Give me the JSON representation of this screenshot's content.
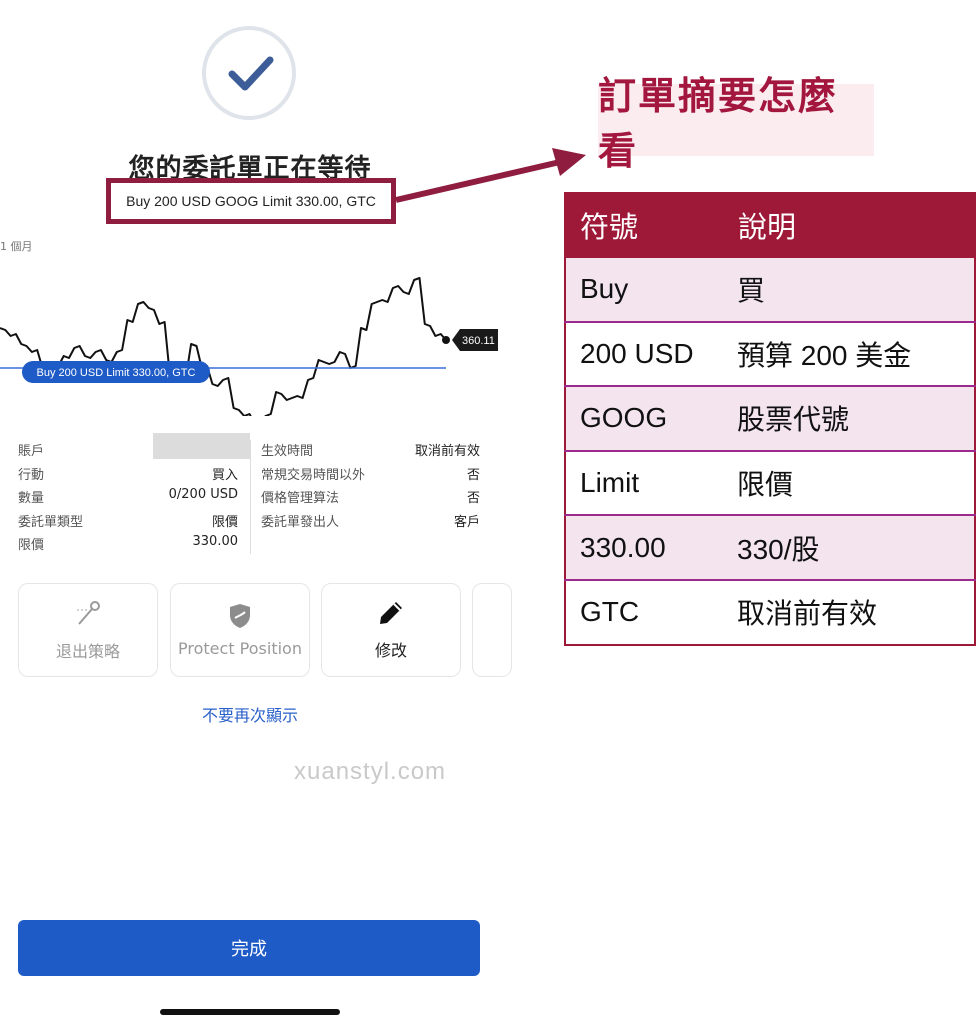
{
  "status": {
    "title": "您的委託單正在等待"
  },
  "order": {
    "summary": "Buy 200 USD GOOG Limit 330.00, GTC"
  },
  "chart": {
    "range_label": "1 個月",
    "last_price_label": "360.11",
    "limit_line_label": "Buy 200 USD Limit 330.00, GTC",
    "colors": {
      "line": "#111111",
      "limit": "#3a6fd8",
      "badge": "#1a1a1a"
    }
  },
  "chart_data": {
    "type": "line",
    "series": [
      {
        "values": [
          340,
          338,
          336,
          334,
          330,
          330,
          333,
          335,
          333,
          334,
          332,
          334,
          342,
          346,
          345,
          341,
          328,
          327,
          336,
          330,
          326,
          327,
          320,
          318,
          316,
          318,
          324,
          322,
          323,
          327,
          332,
          331,
          334,
          330,
          340,
          346,
          347,
          350,
          349,
          352,
          341,
          338,
          337
        ]
      }
    ],
    "reference_lines": [
      {
        "label": "Buy 200 USD Limit 330.00, GTC",
        "value": 330.0
      }
    ],
    "last_value": 360.11,
    "ylim": [
      320,
      362
    ]
  },
  "details": {
    "left": [
      {
        "label": "賬戶",
        "value": ""
      },
      {
        "label": "行動",
        "value": "買入"
      },
      {
        "label": "數量",
        "value": "0/200 USD"
      },
      {
        "label": "委託單類型",
        "value": "限價"
      },
      {
        "label": "限價",
        "value": "330.00"
      }
    ],
    "right": [
      {
        "label": "生效時間",
        "value": "取消前有效"
      },
      {
        "label": "常規交易時間以外",
        "value": "否"
      },
      {
        "label": "價格管理算法",
        "value": "否"
      },
      {
        "label": "委託單發出人",
        "value": "客戶"
      }
    ]
  },
  "actions": [
    {
      "label": "退出策略",
      "icon": "exit-strategy-icon"
    },
    {
      "label": "Protect Position",
      "icon": "shield-icon"
    },
    {
      "label": "修改",
      "icon": "pencil-icon"
    }
  ],
  "links": {
    "dont_show_again": "不要再次顯示"
  },
  "watermark": "xuanstyl.com",
  "buttons": {
    "done": "完成"
  },
  "callout": {
    "title": "訂單摘要怎麼看"
  },
  "legend": {
    "headers": [
      "符號",
      "說明"
    ],
    "rows": [
      [
        "Buy",
        "買"
      ],
      [
        "200 USD",
        "預算 200 美金"
      ],
      [
        "GOOG",
        "股票代號"
      ],
      [
        "Limit",
        "限價"
      ],
      [
        "330.00",
        "330/股"
      ],
      [
        "GTC",
        "取消前有效"
      ]
    ],
    "colors": {
      "header": "#9e1838",
      "row_alt": "#f3e4ee",
      "border": "#9b2a8c"
    }
  }
}
